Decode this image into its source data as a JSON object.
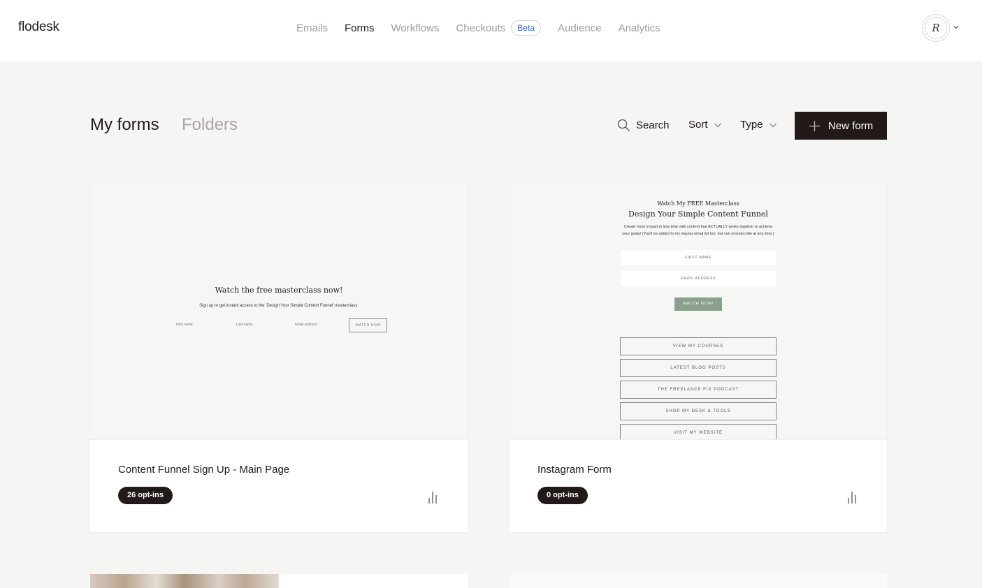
{
  "app": {
    "logo": "flodesk"
  },
  "nav": {
    "items": [
      {
        "label": "Emails",
        "active": false
      },
      {
        "label": "Forms",
        "active": true
      },
      {
        "label": "Workflows",
        "active": false
      },
      {
        "label": "Checkouts",
        "active": false,
        "badge": "Beta"
      },
      {
        "label": "Audience",
        "active": false
      },
      {
        "label": "Analytics",
        "active": false
      }
    ]
  },
  "user": {
    "avatar_initial": "R",
    "menu_icon": "chevron-down-icon"
  },
  "header": {
    "title": "My forms",
    "folders_tab": "Folders",
    "search_label": "Search",
    "sort_label": "Sort",
    "type_label": "Type",
    "new_form_label": "New form"
  },
  "colors": {
    "accent_dark": "#211a18",
    "beta_text": "#2e6bd6",
    "watch_button": "#8aa08c",
    "page_bg": "#f5f5f4"
  },
  "forms": [
    {
      "name": "Content Funnel Sign Up - Main Page",
      "optins": "26 opt-ins",
      "preview": {
        "title": "Watch the free masterclass now!",
        "subtitle": "Sign up to get instant access to the 'Design Your Simple Content Funnel' masterclass.",
        "fields": [
          "First name",
          "Last name",
          "Email address"
        ],
        "button": "WATCH NOW"
      }
    },
    {
      "name": "Instagram Form",
      "optins": "0 opt-ins",
      "preview": {
        "pretitle": "Watch My FREE Masterclass",
        "title": "Design Your Simple Content Funnel",
        "description": "Create more impact in less time with content that ACTUALLY works together to achieve your goals! (You'll be added to my regular email list too, but can unsubscribe at any time.)",
        "fields": [
          "FIRST NAME",
          "EMAIL ADDRESS"
        ],
        "button": "WATCH NOW!",
        "links": [
          "VIEW MY COURSES",
          "LATEST BLOG POSTS",
          "THE FREELANCE FIX PODCAST",
          "SHOP MY DESK & TOOLS",
          "VISIT MY WEBSITE"
        ]
      }
    }
  ]
}
